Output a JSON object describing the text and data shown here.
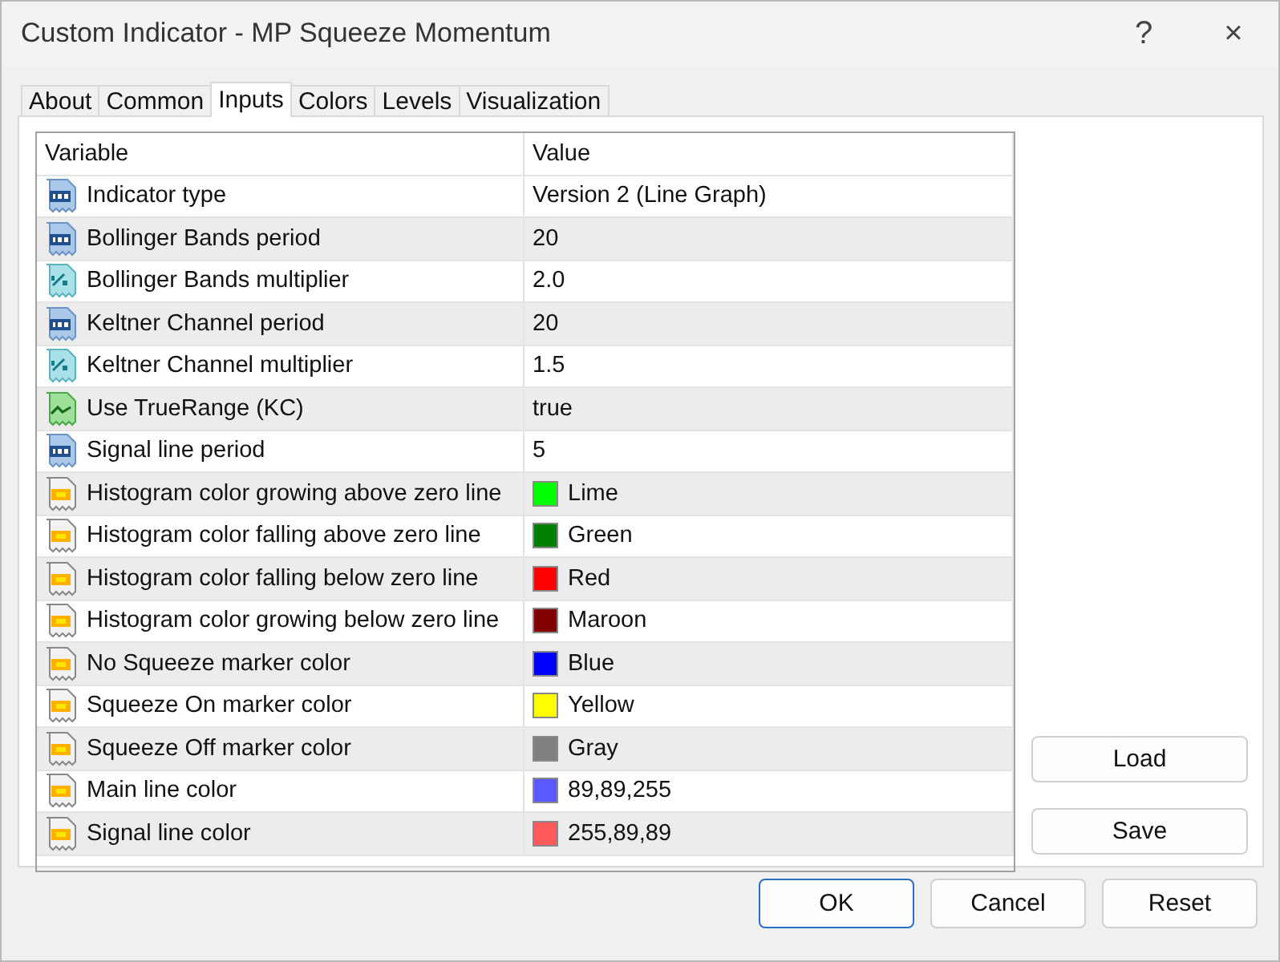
{
  "window": {
    "title": "Custom Indicator - MP Squeeze Momentum",
    "help": "?",
    "close": "×"
  },
  "tabs": [
    {
      "label": "About",
      "selected": false
    },
    {
      "label": "Common",
      "selected": false
    },
    {
      "label": "Inputs",
      "selected": true
    },
    {
      "label": "Colors",
      "selected": false
    },
    {
      "label": "Levels",
      "selected": false
    },
    {
      "label": "Visualization",
      "selected": false
    }
  ],
  "table": {
    "columns": [
      "Variable",
      "Value"
    ],
    "rows": [
      {
        "kind": "integer",
        "variable": "Indicator type",
        "value": "Version 2 (Line Graph)"
      },
      {
        "kind": "integer",
        "variable": "Bollinger Bands period",
        "value": "20"
      },
      {
        "kind": "double",
        "variable": "Bollinger Bands multiplier",
        "value": "2.0"
      },
      {
        "kind": "integer",
        "variable": "Keltner Channel period",
        "value": "20"
      },
      {
        "kind": "double",
        "variable": "Keltner Channel multiplier",
        "value": "1.5"
      },
      {
        "kind": "bool",
        "variable": "Use TrueRange (KC)",
        "value": "true"
      },
      {
        "kind": "integer",
        "variable": "Signal line period",
        "value": "5"
      },
      {
        "kind": "color",
        "variable": "Histogram color growing above zero line",
        "value": "Lime",
        "color": "#00ff00"
      },
      {
        "kind": "color",
        "variable": "Histogram color falling above zero line",
        "value": "Green",
        "color": "#008000"
      },
      {
        "kind": "color",
        "variable": "Histogram color falling below zero line",
        "value": "Red",
        "color": "#ff0000"
      },
      {
        "kind": "color",
        "variable": "Histogram color growing below zero line",
        "value": "Maroon",
        "color": "#800000"
      },
      {
        "kind": "color",
        "variable": "No Squeeze marker color",
        "value": "Blue",
        "color": "#0000ff"
      },
      {
        "kind": "color",
        "variable": "Squeeze On marker color",
        "value": "Yellow",
        "color": "#ffff00"
      },
      {
        "kind": "color",
        "variable": "Squeeze Off marker color",
        "value": "Gray",
        "color": "#808080"
      },
      {
        "kind": "color",
        "variable": "Main line color",
        "value": "89,89,255",
        "color": "#5959ff"
      },
      {
        "kind": "color",
        "variable": "Signal line color",
        "value": "255,89,89",
        "color": "#ff5959"
      }
    ]
  },
  "side_buttons": [
    "Load",
    "Save"
  ],
  "buttons": [
    {
      "label": "OK",
      "selected": true
    },
    {
      "label": "Cancel",
      "selected": false
    },
    {
      "label": "Reset",
      "selected": false
    }
  ]
}
